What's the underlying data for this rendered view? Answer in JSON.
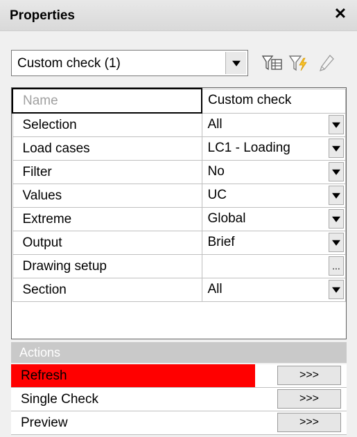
{
  "panel": {
    "title": "Properties",
    "close_icon": "close-icon"
  },
  "combo": {
    "selected": "Custom check (1)"
  },
  "toolbar": {
    "icons": [
      "filter-table-icon",
      "filter-lightning-icon",
      "pencil-icon"
    ]
  },
  "grid": {
    "rows": [
      {
        "label": "Name",
        "value": "Custom check",
        "control": "none"
      },
      {
        "label": "Selection",
        "value": "All",
        "control": "dropdown"
      },
      {
        "label": "Load cases",
        "value": "LC1 - Loading",
        "control": "dropdown"
      },
      {
        "label": "Filter",
        "value": "No",
        "control": "dropdown"
      },
      {
        "label": "Values",
        "value": "UC",
        "control": "dropdown"
      },
      {
        "label": "Extreme",
        "value": "Global",
        "control": "dropdown"
      },
      {
        "label": "Output",
        "value": "Brief",
        "control": "dropdown"
      },
      {
        "label": "Drawing setup",
        "value": "",
        "control": "ellipsis",
        "ellipsis_label": "..."
      },
      {
        "label": "Section",
        "value": "All",
        "control": "dropdown"
      }
    ]
  },
  "actions": {
    "header": "Actions",
    "items": [
      {
        "label": "Refresh",
        "button": ">>>",
        "highlight_color": "#ff0000"
      },
      {
        "label": "Single Check",
        "button": ">>>"
      },
      {
        "label": "Preview",
        "button": ">>>"
      }
    ]
  }
}
